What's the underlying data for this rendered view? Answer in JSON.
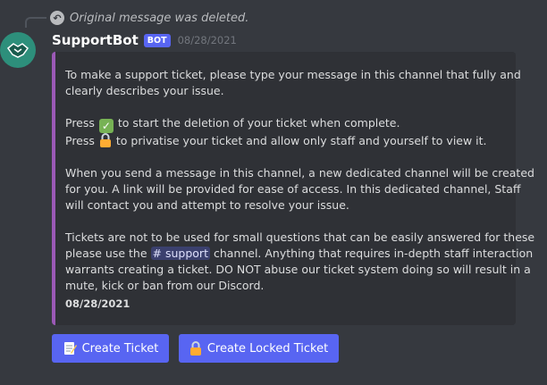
{
  "reply": {
    "text": "Original message was deleted.",
    "icon": "reply-arrow-icon"
  },
  "message": {
    "author": "SupportBot",
    "badge": "BOT",
    "timestamp": "08/28/2021",
    "avatar_icon": "handshake-icon",
    "avatar_color": "#2d8f7b"
  },
  "embed": {
    "accent_color": "#9b59b6",
    "paragraphs": [
      [
        "To make a support ticket, please type your message in this channel that fully and",
        "clearly describes your issue."
      ],
      [
        "When you send a message in this channel, a new dedicated channel will be created",
        "for you. A link will be provided for ease of access. In this dedicated channel, Staff",
        "will contact you and attempt to resolve your issue."
      ]
    ],
    "press_check": {
      "prefix": "Press",
      "suffix": "to start the deletion of your ticket when complete.",
      "icon": "check-mark-icon"
    },
    "press_lock": {
      "prefix": "Press",
      "suffix": "to privatise your ticket and allow only staff and yourself to view it.",
      "icon": "lock-icon"
    },
    "tickets": {
      "line1": "Tickets are not to be used for small questions that can be easily answered for these",
      "line2_before": "please use the",
      "channel_mention": "# support",
      "line2_after": "channel. Anything that requires in-depth staff interaction",
      "line3": "warrants creating a ticket. DO NOT abuse our ticket system doing so will result in a",
      "line4": "mute, kick or ban from our Discord."
    },
    "footer": "08/28/2021"
  },
  "buttons": {
    "create_ticket": {
      "label": "Create Ticket",
      "icon": "memo-icon"
    },
    "create_locked": {
      "label": "Create Locked Ticket",
      "icon": "lock-icon"
    },
    "color": "#5865f2"
  }
}
